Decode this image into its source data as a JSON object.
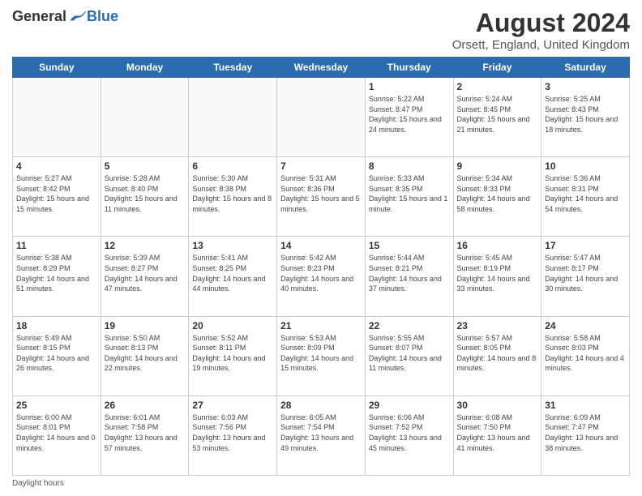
{
  "header": {
    "logo_general": "General",
    "logo_blue": "Blue",
    "month_year": "August 2024",
    "location": "Orsett, England, United Kingdom"
  },
  "days_of_week": [
    "Sunday",
    "Monday",
    "Tuesday",
    "Wednesday",
    "Thursday",
    "Friday",
    "Saturday"
  ],
  "weeks": [
    [
      {
        "day": "",
        "sunrise": "",
        "sunset": "",
        "daylight": "",
        "empty": true
      },
      {
        "day": "",
        "sunrise": "",
        "sunset": "",
        "daylight": "",
        "empty": true
      },
      {
        "day": "",
        "sunrise": "",
        "sunset": "",
        "daylight": "",
        "empty": true
      },
      {
        "day": "",
        "sunrise": "",
        "sunset": "",
        "daylight": "",
        "empty": true
      },
      {
        "day": "1",
        "sunrise": "Sunrise: 5:22 AM",
        "sunset": "Sunset: 8:47 PM",
        "daylight": "Daylight: 15 hours and 24 minutes.",
        "empty": false
      },
      {
        "day": "2",
        "sunrise": "Sunrise: 5:24 AM",
        "sunset": "Sunset: 8:45 PM",
        "daylight": "Daylight: 15 hours and 21 minutes.",
        "empty": false
      },
      {
        "day": "3",
        "sunrise": "Sunrise: 5:25 AM",
        "sunset": "Sunset: 8:43 PM",
        "daylight": "Daylight: 15 hours and 18 minutes.",
        "empty": false
      }
    ],
    [
      {
        "day": "4",
        "sunrise": "Sunrise: 5:27 AM",
        "sunset": "Sunset: 8:42 PM",
        "daylight": "Daylight: 15 hours and 15 minutes.",
        "empty": false
      },
      {
        "day": "5",
        "sunrise": "Sunrise: 5:28 AM",
        "sunset": "Sunset: 8:40 PM",
        "daylight": "Daylight: 15 hours and 11 minutes.",
        "empty": false
      },
      {
        "day": "6",
        "sunrise": "Sunrise: 5:30 AM",
        "sunset": "Sunset: 8:38 PM",
        "daylight": "Daylight: 15 hours and 8 minutes.",
        "empty": false
      },
      {
        "day": "7",
        "sunrise": "Sunrise: 5:31 AM",
        "sunset": "Sunset: 8:36 PM",
        "daylight": "Daylight: 15 hours and 5 minutes.",
        "empty": false
      },
      {
        "day": "8",
        "sunrise": "Sunrise: 5:33 AM",
        "sunset": "Sunset: 8:35 PM",
        "daylight": "Daylight: 15 hours and 1 minute.",
        "empty": false
      },
      {
        "day": "9",
        "sunrise": "Sunrise: 5:34 AM",
        "sunset": "Sunset: 8:33 PM",
        "daylight": "Daylight: 14 hours and 58 minutes.",
        "empty": false
      },
      {
        "day": "10",
        "sunrise": "Sunrise: 5:36 AM",
        "sunset": "Sunset: 8:31 PM",
        "daylight": "Daylight: 14 hours and 54 minutes.",
        "empty": false
      }
    ],
    [
      {
        "day": "11",
        "sunrise": "Sunrise: 5:38 AM",
        "sunset": "Sunset: 8:29 PM",
        "daylight": "Daylight: 14 hours and 51 minutes.",
        "empty": false
      },
      {
        "day": "12",
        "sunrise": "Sunrise: 5:39 AM",
        "sunset": "Sunset: 8:27 PM",
        "daylight": "Daylight: 14 hours and 47 minutes.",
        "empty": false
      },
      {
        "day": "13",
        "sunrise": "Sunrise: 5:41 AM",
        "sunset": "Sunset: 8:25 PM",
        "daylight": "Daylight: 14 hours and 44 minutes.",
        "empty": false
      },
      {
        "day": "14",
        "sunrise": "Sunrise: 5:42 AM",
        "sunset": "Sunset: 8:23 PM",
        "daylight": "Daylight: 14 hours and 40 minutes.",
        "empty": false
      },
      {
        "day": "15",
        "sunrise": "Sunrise: 5:44 AM",
        "sunset": "Sunset: 8:21 PM",
        "daylight": "Daylight: 14 hours and 37 minutes.",
        "empty": false
      },
      {
        "day": "16",
        "sunrise": "Sunrise: 5:45 AM",
        "sunset": "Sunset: 8:19 PM",
        "daylight": "Daylight: 14 hours and 33 minutes.",
        "empty": false
      },
      {
        "day": "17",
        "sunrise": "Sunrise: 5:47 AM",
        "sunset": "Sunset: 8:17 PM",
        "daylight": "Daylight: 14 hours and 30 minutes.",
        "empty": false
      }
    ],
    [
      {
        "day": "18",
        "sunrise": "Sunrise: 5:49 AM",
        "sunset": "Sunset: 8:15 PM",
        "daylight": "Daylight: 14 hours and 26 minutes.",
        "empty": false
      },
      {
        "day": "19",
        "sunrise": "Sunrise: 5:50 AM",
        "sunset": "Sunset: 8:13 PM",
        "daylight": "Daylight: 14 hours and 22 minutes.",
        "empty": false
      },
      {
        "day": "20",
        "sunrise": "Sunrise: 5:52 AM",
        "sunset": "Sunset: 8:11 PM",
        "daylight": "Daylight: 14 hours and 19 minutes.",
        "empty": false
      },
      {
        "day": "21",
        "sunrise": "Sunrise: 5:53 AM",
        "sunset": "Sunset: 8:09 PM",
        "daylight": "Daylight: 14 hours and 15 minutes.",
        "empty": false
      },
      {
        "day": "22",
        "sunrise": "Sunrise: 5:55 AM",
        "sunset": "Sunset: 8:07 PM",
        "daylight": "Daylight: 14 hours and 11 minutes.",
        "empty": false
      },
      {
        "day": "23",
        "sunrise": "Sunrise: 5:57 AM",
        "sunset": "Sunset: 8:05 PM",
        "daylight": "Daylight: 14 hours and 8 minutes.",
        "empty": false
      },
      {
        "day": "24",
        "sunrise": "Sunrise: 5:58 AM",
        "sunset": "Sunset: 8:03 PM",
        "daylight": "Daylight: 14 hours and 4 minutes.",
        "empty": false
      }
    ],
    [
      {
        "day": "25",
        "sunrise": "Sunrise: 6:00 AM",
        "sunset": "Sunset: 8:01 PM",
        "daylight": "Daylight: 14 hours and 0 minutes.",
        "empty": false
      },
      {
        "day": "26",
        "sunrise": "Sunrise: 6:01 AM",
        "sunset": "Sunset: 7:58 PM",
        "daylight": "Daylight: 13 hours and 57 minutes.",
        "empty": false
      },
      {
        "day": "27",
        "sunrise": "Sunrise: 6:03 AM",
        "sunset": "Sunset: 7:56 PM",
        "daylight": "Daylight: 13 hours and 53 minutes.",
        "empty": false
      },
      {
        "day": "28",
        "sunrise": "Sunrise: 6:05 AM",
        "sunset": "Sunset: 7:54 PM",
        "daylight": "Daylight: 13 hours and 49 minutes.",
        "empty": false
      },
      {
        "day": "29",
        "sunrise": "Sunrise: 6:06 AM",
        "sunset": "Sunset: 7:52 PM",
        "daylight": "Daylight: 13 hours and 45 minutes.",
        "empty": false
      },
      {
        "day": "30",
        "sunrise": "Sunrise: 6:08 AM",
        "sunset": "Sunset: 7:50 PM",
        "daylight": "Daylight: 13 hours and 41 minutes.",
        "empty": false
      },
      {
        "day": "31",
        "sunrise": "Sunrise: 6:09 AM",
        "sunset": "Sunset: 7:47 PM",
        "daylight": "Daylight: 13 hours and 38 minutes.",
        "empty": false
      }
    ]
  ],
  "footer": {
    "note": "Daylight hours"
  }
}
